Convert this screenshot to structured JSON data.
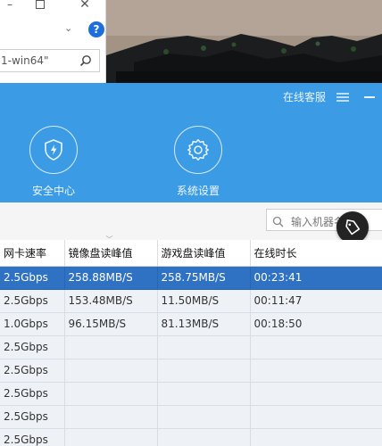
{
  "explorer": {
    "minimize_icon": "minimize-icon",
    "maximize_icon": "maximize-icon",
    "close_icon": "close-icon",
    "search_value": "1-win64\"",
    "help_label": "?"
  },
  "app": {
    "accent_color": "#3b9be5",
    "header": {
      "service_label": "在线客服",
      "menu_icon": "hamburger-menu-icon",
      "minimize_icon": "minimize-icon"
    },
    "nav": [
      {
        "label": "安全中心",
        "icon": "shield-lightning-icon"
      },
      {
        "label": "系统设置",
        "icon": "gear-icon"
      }
    ],
    "filter": {
      "placeholder": "输入机器名"
    },
    "fab_icon": "tag-icon"
  },
  "table": {
    "columns": [
      "网卡速率",
      "镜像盘读峰值",
      "游戏盘读峰值",
      "在线时长"
    ],
    "rows": [
      {
        "nic": "2.5Gbps",
        "image_peak": "258.88MB/S",
        "game_peak": "258.75MB/S",
        "online": "00:23:41",
        "selected": true
      },
      {
        "nic": "2.5Gbps",
        "image_peak": "153.48MB/S",
        "game_peak": "11.50MB/S",
        "online": "00:11:47",
        "selected": false
      },
      {
        "nic": "1.0Gbps",
        "image_peak": "96.15MB/S",
        "game_peak": "81.13MB/S",
        "online": "00:18:50",
        "selected": false
      },
      {
        "nic": "2.5Gbps",
        "image_peak": "",
        "game_peak": "",
        "online": "",
        "selected": false
      },
      {
        "nic": "2.5Gbps",
        "image_peak": "",
        "game_peak": "",
        "online": "",
        "selected": false
      },
      {
        "nic": "2.5Gbps",
        "image_peak": "",
        "game_peak": "",
        "online": "",
        "selected": false
      },
      {
        "nic": "2.5Gbps",
        "image_peak": "",
        "game_peak": "",
        "online": "",
        "selected": false
      },
      {
        "nic": "2.5Gbps",
        "image_peak": "",
        "game_peak": "",
        "online": "",
        "selected": false
      }
    ]
  }
}
